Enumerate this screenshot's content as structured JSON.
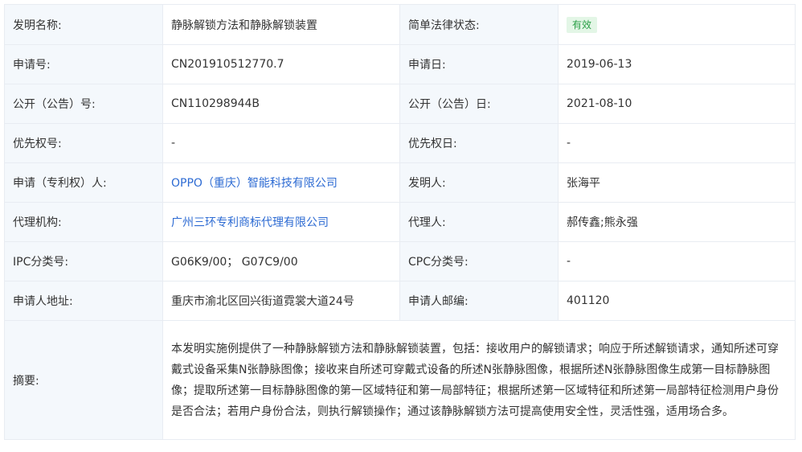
{
  "invention_name": {
    "label": "发明名称:",
    "value": "静脉解锁方法和静脉解锁装置"
  },
  "legal_status": {
    "label": "简单法律状态:",
    "value": "有效",
    "color": "#2a9f46"
  },
  "application_no": {
    "label": "申请号:",
    "value": "CN201910512770.7"
  },
  "application_date": {
    "label": "申请日:",
    "value": "2019-06-13"
  },
  "publication_no": {
    "label": "公开（公告）号:",
    "value": "CN110298944B"
  },
  "publication_date": {
    "label": "公开（公告）日:",
    "value": "2021-08-10"
  },
  "priority_no": {
    "label": "优先权号:",
    "value": "-"
  },
  "priority_date": {
    "label": "优先权日:",
    "value": "-"
  },
  "applicant": {
    "label": "申请（专利权）人:",
    "value": "OPPO（重庆）智能科技有限公司"
  },
  "inventor": {
    "label": "发明人:",
    "value": "张海平"
  },
  "agency": {
    "label": "代理机构:",
    "value": "广州三环专利商标代理有限公司"
  },
  "agent": {
    "label": "代理人:",
    "value": "郝传鑫;熊永强"
  },
  "ipc": {
    "label": "IPC分类号:",
    "value": "G06K9/00； G07C9/00"
  },
  "cpc": {
    "label": "CPC分类号:",
    "value": "-"
  },
  "address": {
    "label": "申请人地址:",
    "value": "重庆市渝北区回兴街道霓裳大道24号"
  },
  "postcode": {
    "label": "申请人邮编:",
    "value": "401120"
  },
  "abstract": {
    "label": "摘要:",
    "value": "本发明实施例提供了一种静脉解锁方法和静脉解锁装置，包括：接收用户的解锁请求；响应于所述解锁请求，通知所述可穿戴式设备采集N张静脉图像；接收来自所述可穿戴式设备的所述N张静脉图像，根据所述N张静脉图像生成第一目标静脉图像；提取所述第一目标静脉图像的第一区域特征和第一局部特征；根据所述第一区域特征和所述第一局部特征检测用户身份是否合法；若用户身份合法，则执行解锁操作；通过该静脉解锁方法可提高使用安全性，灵活性强，适用场合多。"
  }
}
